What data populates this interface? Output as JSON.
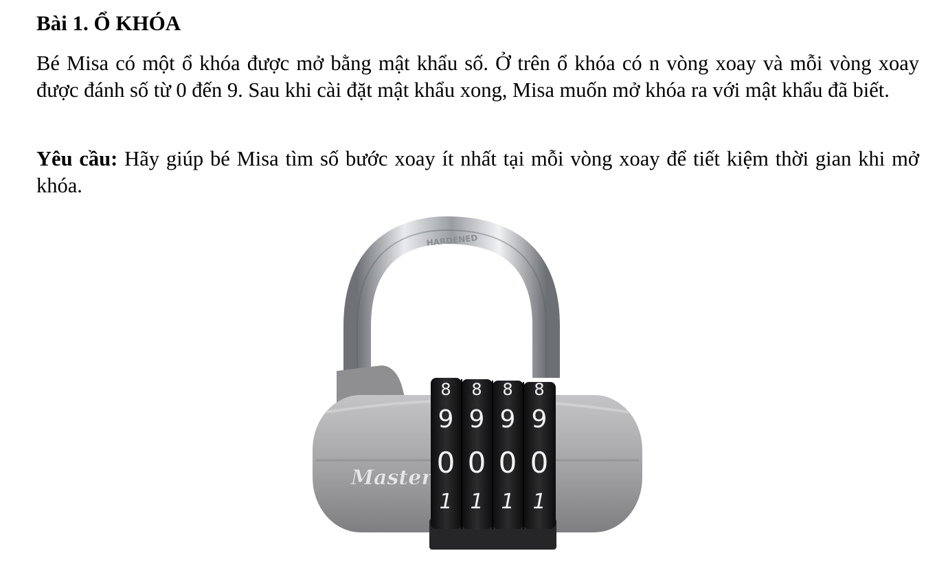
{
  "problem": {
    "title": "Bài 1. Ổ KHÓA",
    "description": "Bé Misa có một ổ khóa được mở bằng mật khẩu số. Ở trên ổ khóa có n vòng xoay và mỗi vòng xoay được đánh số từ 0 đến 9. Sau khi cài đặt mật khẩu xong, Misa muốn mở khóa ra với mật khẩu đã biết.",
    "requirement_label": "Yêu cầu:",
    "requirement_text": " Hãy giúp bé Misa tìm số bước xoay ít nhất tại mỗi vòng xoay để tiết kiệm thời gian khi mở khóa."
  },
  "figure": {
    "brand": "Master",
    "shackle_engraving": "HARDENED",
    "dial_rows": [
      [
        "8",
        "8",
        "8",
        "8"
      ],
      [
        "9",
        "9",
        "9",
        "9"
      ],
      [
        "0",
        "0",
        "0",
        "0"
      ],
      [
        "1",
        "1",
        "1",
        "1"
      ]
    ],
    "colors": {
      "body": "#a9a9ab",
      "body_dark": "#7f7f82",
      "dial": "#1b1b1d",
      "digit": "#f2f2f2",
      "shackle": "#c9ccd0"
    }
  }
}
